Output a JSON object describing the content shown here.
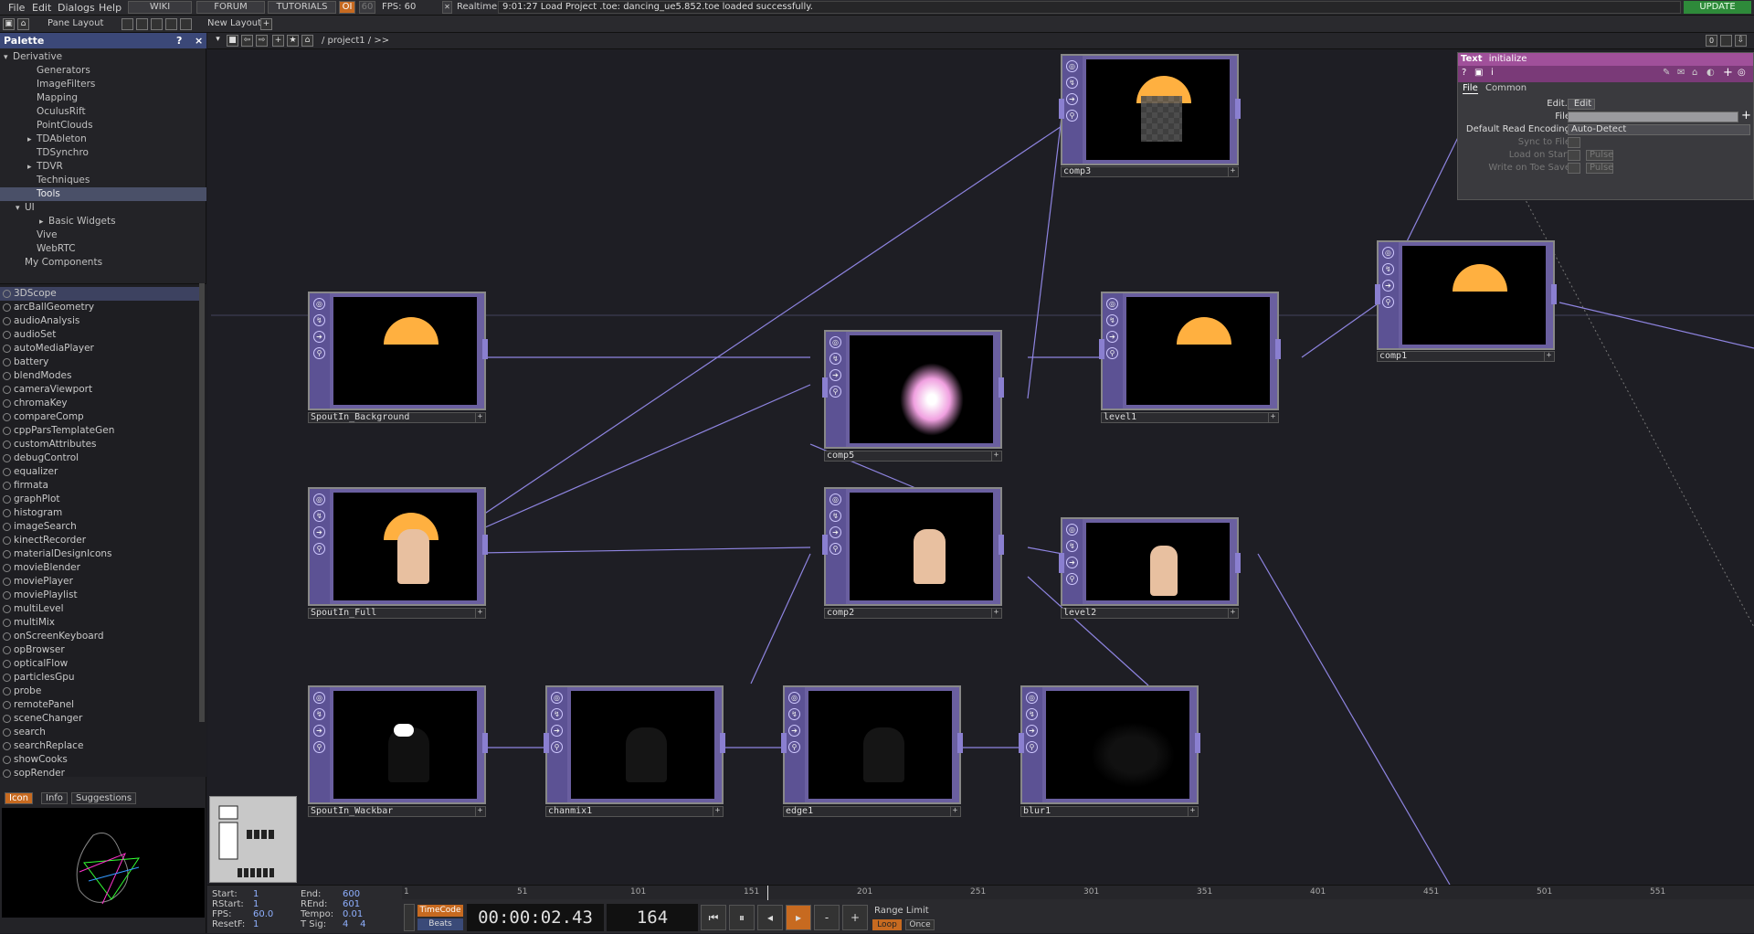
{
  "menu": {
    "file": "File",
    "edit": "Edit",
    "dialogs": "Dialogs",
    "help": "Help"
  },
  "toolbar": {
    "wiki": "WIKI",
    "forum": "FORUM",
    "tutorials": "TUTORIALS",
    "oi": "OI",
    "fps_cap": "60",
    "fps": "FPS:  60",
    "realtime": "Realtime",
    "message": "9:01:27 Load Project .toe: dancing_ue5.852.toe loaded successfully.",
    "update": "UPDATE"
  },
  "bar2": {
    "pane_layout": "Pane Layout",
    "new_layout": "New Layout",
    "path": "/ project1 / >>"
  },
  "palette": {
    "title": "Palette",
    "help": "?",
    "close": "×",
    "tree": [
      {
        "label": "Derivative",
        "indent": 0,
        "arrow": "▾"
      },
      {
        "label": "Generators",
        "indent": 2,
        "arrow": ""
      },
      {
        "label": "ImageFilters",
        "indent": 2,
        "arrow": ""
      },
      {
        "label": "Mapping",
        "indent": 2,
        "arrow": ""
      },
      {
        "label": "OculusRift",
        "indent": 2,
        "arrow": ""
      },
      {
        "label": "PointClouds",
        "indent": 2,
        "arrow": ""
      },
      {
        "label": "TDAbleton",
        "indent": 2,
        "arrow": "▸"
      },
      {
        "label": "TDSynchro",
        "indent": 2,
        "arrow": ""
      },
      {
        "label": "TDVR",
        "indent": 2,
        "arrow": "▸"
      },
      {
        "label": "Techniques",
        "indent": 2,
        "arrow": ""
      },
      {
        "label": "Tools",
        "indent": 2,
        "arrow": "",
        "selected": true
      },
      {
        "label": "UI",
        "indent": 1,
        "arrow": "▾"
      },
      {
        "label": "Basic Widgets",
        "indent": 3,
        "arrow": "▸"
      },
      {
        "label": "Vive",
        "indent": 2,
        "arrow": ""
      },
      {
        "label": "WebRTC",
        "indent": 2,
        "arrow": ""
      },
      {
        "label": "My Components",
        "indent": 1,
        "arrow": ""
      }
    ],
    "components": [
      "3DScope",
      "arcBallGeometry",
      "audioAnalysis",
      "audioSet",
      "autoMediaPlayer",
      "battery",
      "blendModes",
      "cameraViewport",
      "chromaKey",
      "compareComp",
      "cppParsTemplateGen",
      "customAttributes",
      "debugControl",
      "equalizer",
      "firmata",
      "graphPlot",
      "histogram",
      "imageSearch",
      "kinectRecorder",
      "materialDesignIcons",
      "movieBlender",
      "moviePlayer",
      "moviePlaylist",
      "multiLevel",
      "multiMix",
      "onScreenKeyboard",
      "opBrowser",
      "opticalFlow",
      "particlesGpu",
      "probe",
      "remotePanel",
      "sceneChanger",
      "search",
      "searchReplace",
      "showCooks",
      "sopRender"
    ],
    "preview_tabs": [
      "Icon",
      "Info",
      "Suggestions"
    ]
  },
  "nodes": {
    "comp3": "comp3",
    "spoutin_background": "SpoutIn_Background",
    "comp5": "comp5",
    "level1": "level1",
    "comp1": "comp1",
    "spoutin_full": "SpoutIn_Full",
    "comp2": "comp2",
    "level2": "level2",
    "spoutin_wackbar": "SpoutIn_Wackbar",
    "chanmix1": "chanmix1",
    "edge1": "edge1",
    "blur1": "blur1"
  },
  "params": {
    "type": "Text",
    "name": "initialize",
    "tabs": [
      "File",
      "Common"
    ],
    "rows": [
      {
        "label": "Edit..",
        "value": "Edit",
        "dim": false
      },
      {
        "label": "File",
        "value": "",
        "dim": false
      },
      {
        "label": "Default Read Encoding",
        "value": "Auto-Detect",
        "dim": false
      },
      {
        "label": "Sync to File",
        "value": "",
        "dim": true
      },
      {
        "label": "Load on Start",
        "value": "Pulse",
        "dim": true
      },
      {
        "label": "Write on Toe Save",
        "value": "Pulse",
        "dim": true
      }
    ]
  },
  "timeline": {
    "ticks": [
      "1",
      "51",
      "101",
      "151",
      "201",
      "251",
      "301",
      "351",
      "401",
      "451",
      "501",
      "551"
    ],
    "stats": {
      "start_label": "Start:",
      "start": "1",
      "end_label": "End:",
      "end": "600",
      "rstart_label": "RStart:",
      "rstart": "1",
      "rend_label": "REnd:",
      "rend": "601",
      "fps_label": "FPS:",
      "fps": "60.0",
      "tempo_label": "Tempo:",
      "tempo": "0.01",
      "resetf_label": "ResetF:",
      "resetf": "1",
      "tsig_label": "T Sig:",
      "tsig": "4    4"
    },
    "timecode_btn": "TimeCode",
    "beats_btn": "Beats",
    "timecode": "00:00:02.43",
    "frame": "164",
    "range_limit": "Range Limit",
    "loop": "Loop",
    "once": "Once"
  }
}
